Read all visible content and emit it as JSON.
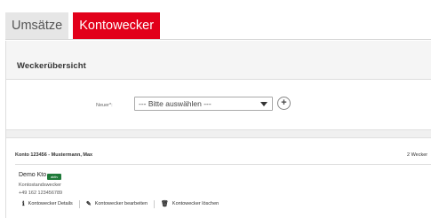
{
  "tabs": {
    "umsaetze": "Umsätze",
    "kontowecker": "Kontowecker"
  },
  "section": {
    "title": "Weckerübersicht"
  },
  "new_select": {
    "label": "Neuer*:",
    "value": "--- Bitte auswählen ---"
  },
  "account": {
    "title": "Konto 123456 - Mustermann, Max",
    "count": "2 Wecker"
  },
  "entry": {
    "name": "Demo Kto",
    "badge": "aktiv",
    "type": "Kontostandswecker",
    "phone": "+49 162 123456789"
  },
  "actions": {
    "details": "Kontowecker Details",
    "edit": "Kontowecker bearbeiten",
    "delete": "Kontowecker löschen"
  },
  "colors": {
    "accent": "#e2001a",
    "badge": "#1f7a3a"
  },
  "icons": {
    "details": "info-icon",
    "edit": "pencil-icon",
    "delete": "trash-icon",
    "add": "plus-icon",
    "dropdown": "chevron-down-icon"
  }
}
